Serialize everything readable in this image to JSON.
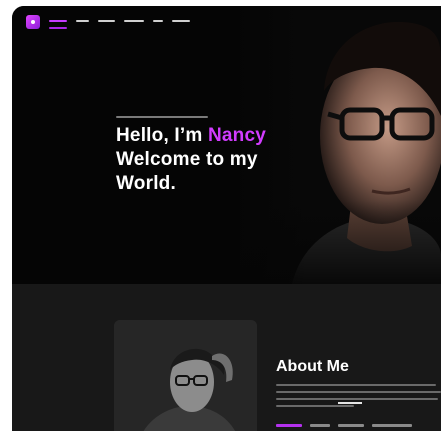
{
  "hero": {
    "heading": {
      "line1_prefix": "Hello, I’m ",
      "line1_name": "Nancy",
      "line2": "Welcome to my",
      "line3": "World."
    }
  },
  "about": {
    "title": "About Me"
  },
  "colors": {
    "accent": "#d23cff",
    "hero_background": "#050505",
    "section_background": "#181818",
    "text": "#ffffff"
  },
  "icons": {
    "logo": "brand-logo-icon"
  }
}
